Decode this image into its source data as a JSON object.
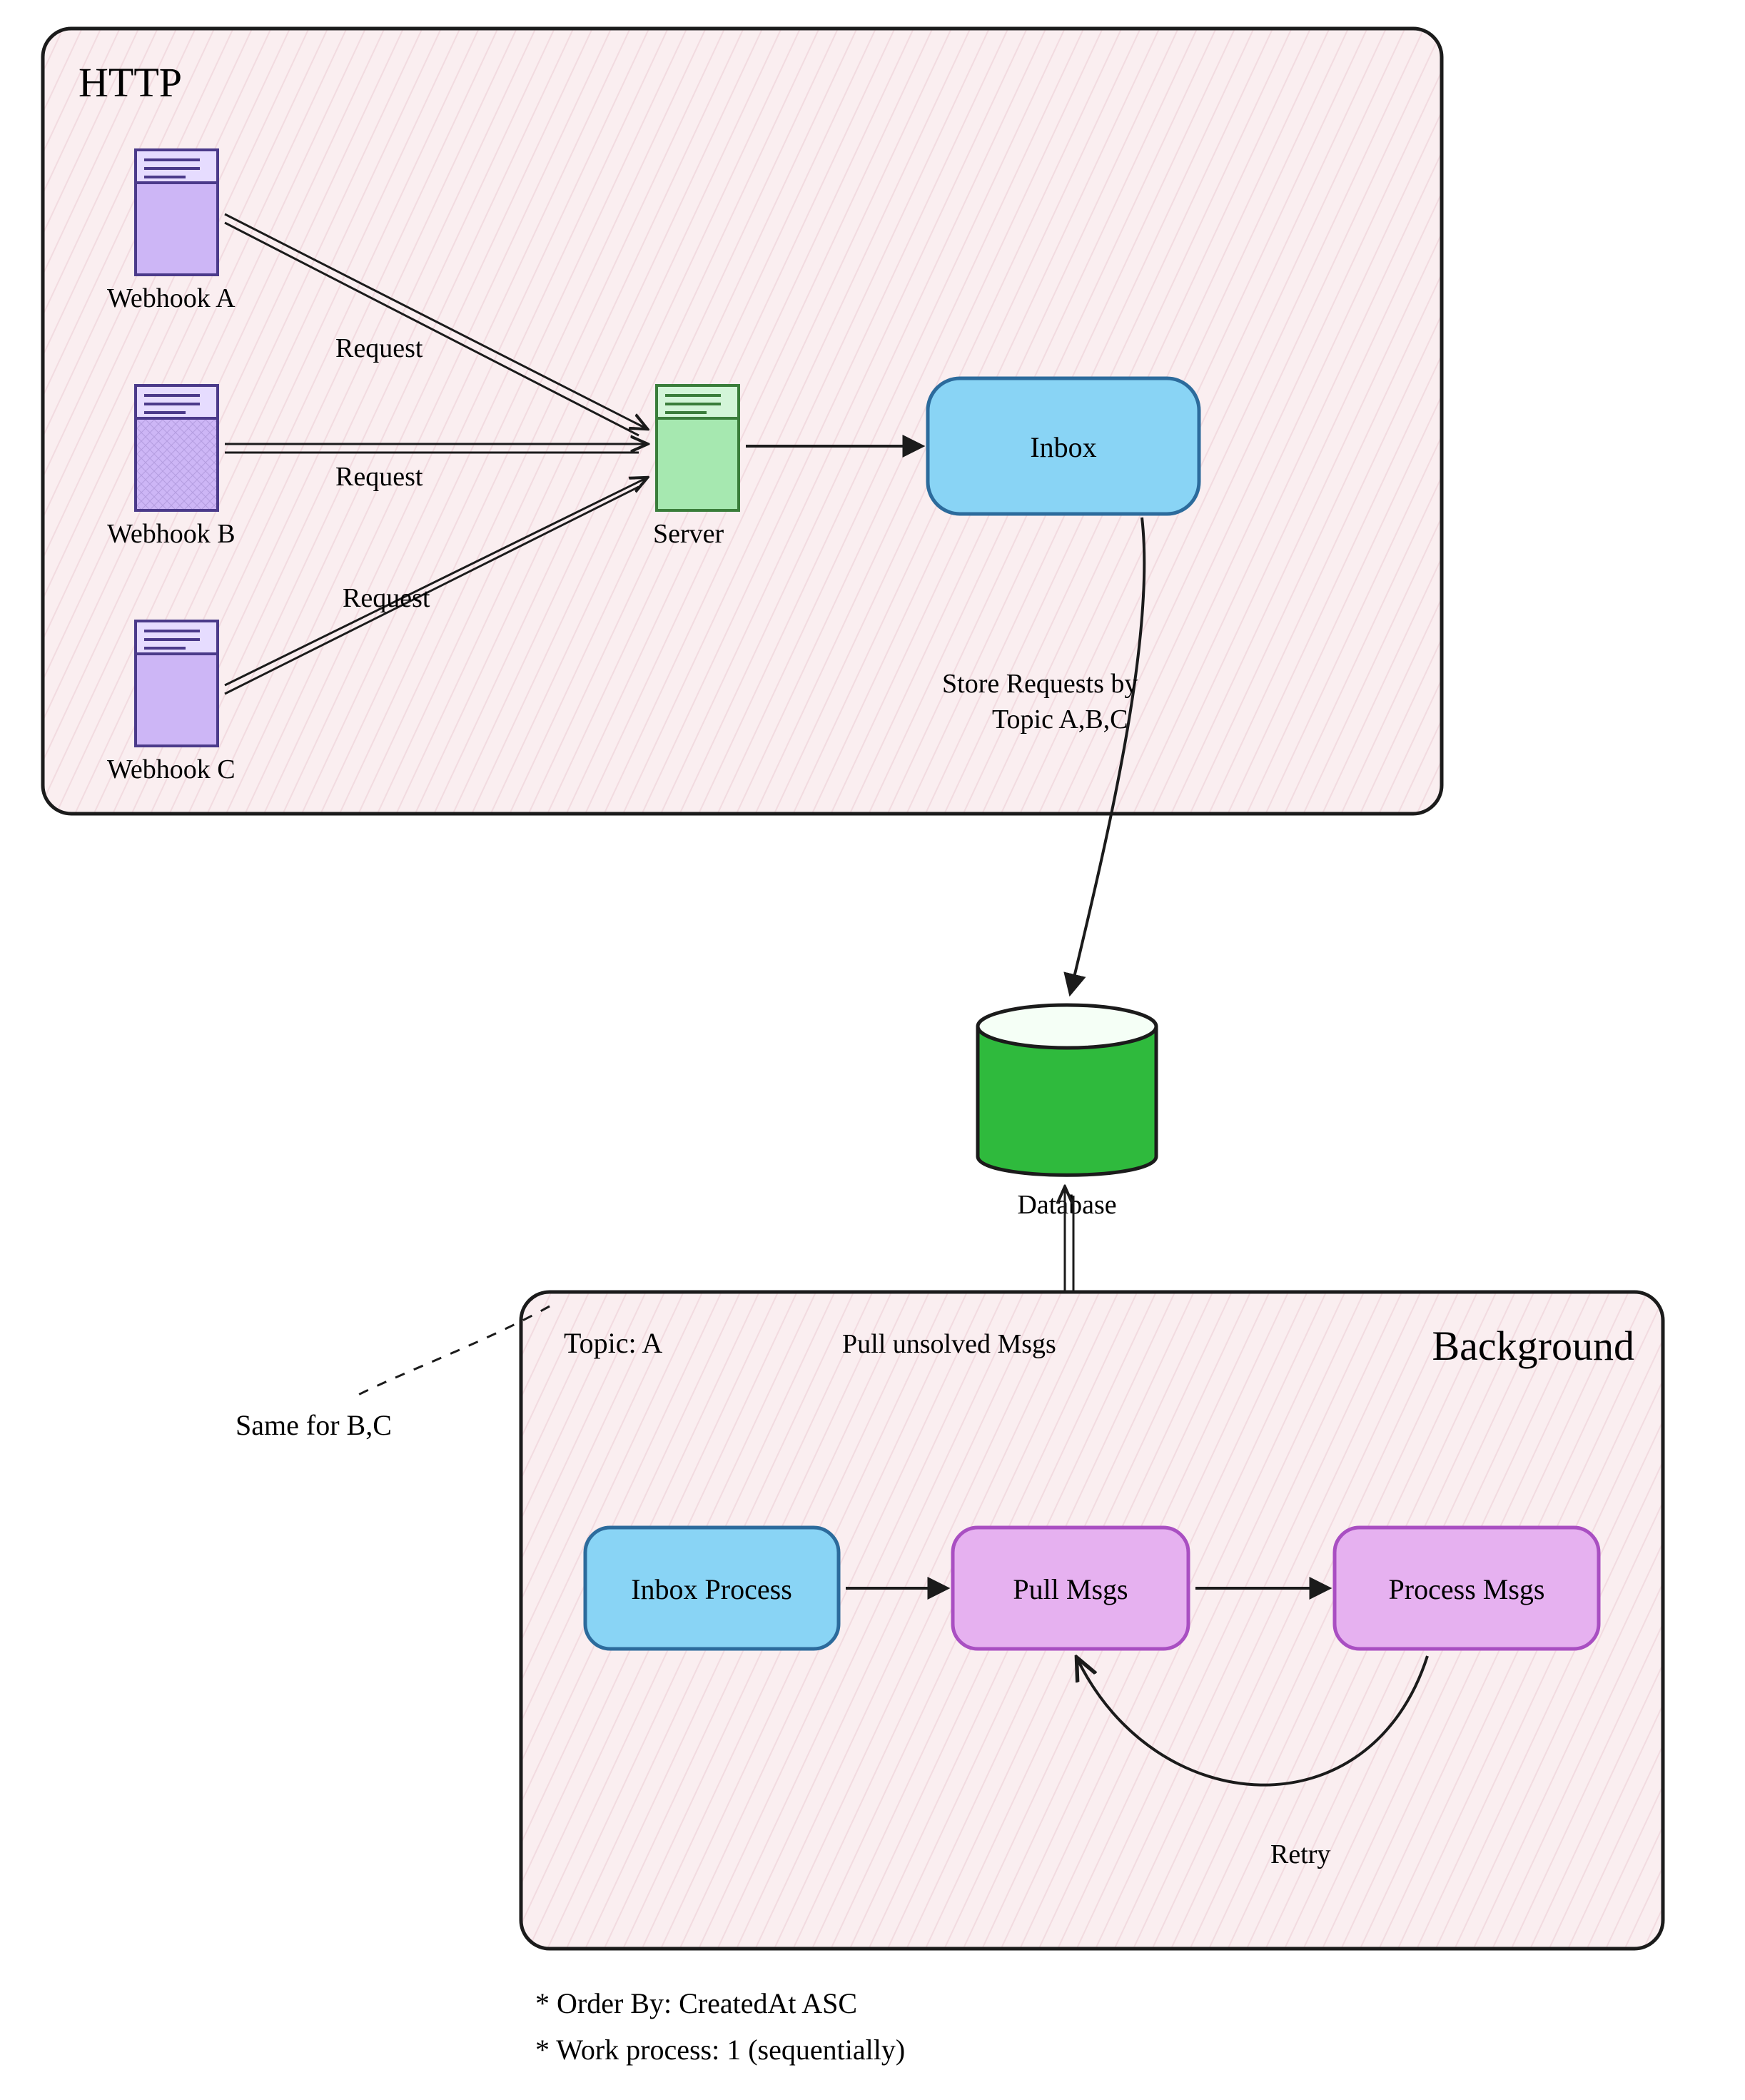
{
  "http": {
    "title": "HTTP",
    "webhooks": [
      "Webhook A",
      "Webhook B",
      "Webhook C"
    ],
    "requests": [
      "Request",
      "Request",
      "Request"
    ],
    "server": "Server",
    "inbox": "Inbox",
    "store": "Store Requests by\nTopic A,B,C"
  },
  "database": "Database",
  "background": {
    "title": "Background",
    "topic": "Topic: A",
    "sameFor": "Same for B,C",
    "pullUnsolved": "Pull unsolved Msgs",
    "inboxProcess": "Inbox Process",
    "pullMsgs": "Pull Msgs",
    "processMsgs": "Process Msgs",
    "retry": "Retry"
  },
  "notes": [
    "* Order By: CreatedAt ASC",
    "* Work process: 1 (sequentially)"
  ],
  "colors": {
    "panelFill": "#faeef0",
    "panelStroke": "#2b2b2b",
    "purpleFill": "#cdb6f6",
    "purpleStroke": "#4b3a8a",
    "greenFill": "#a6e8b0",
    "greenStroke": "#3a7d3a",
    "blueFill": "#89d4f5",
    "blueStroke": "#2c6b9c",
    "dbGreen": "#2fba3d",
    "pinkFill": "#e6b1f0",
    "pinkStroke": "#a94fc2",
    "text": "#111"
  }
}
